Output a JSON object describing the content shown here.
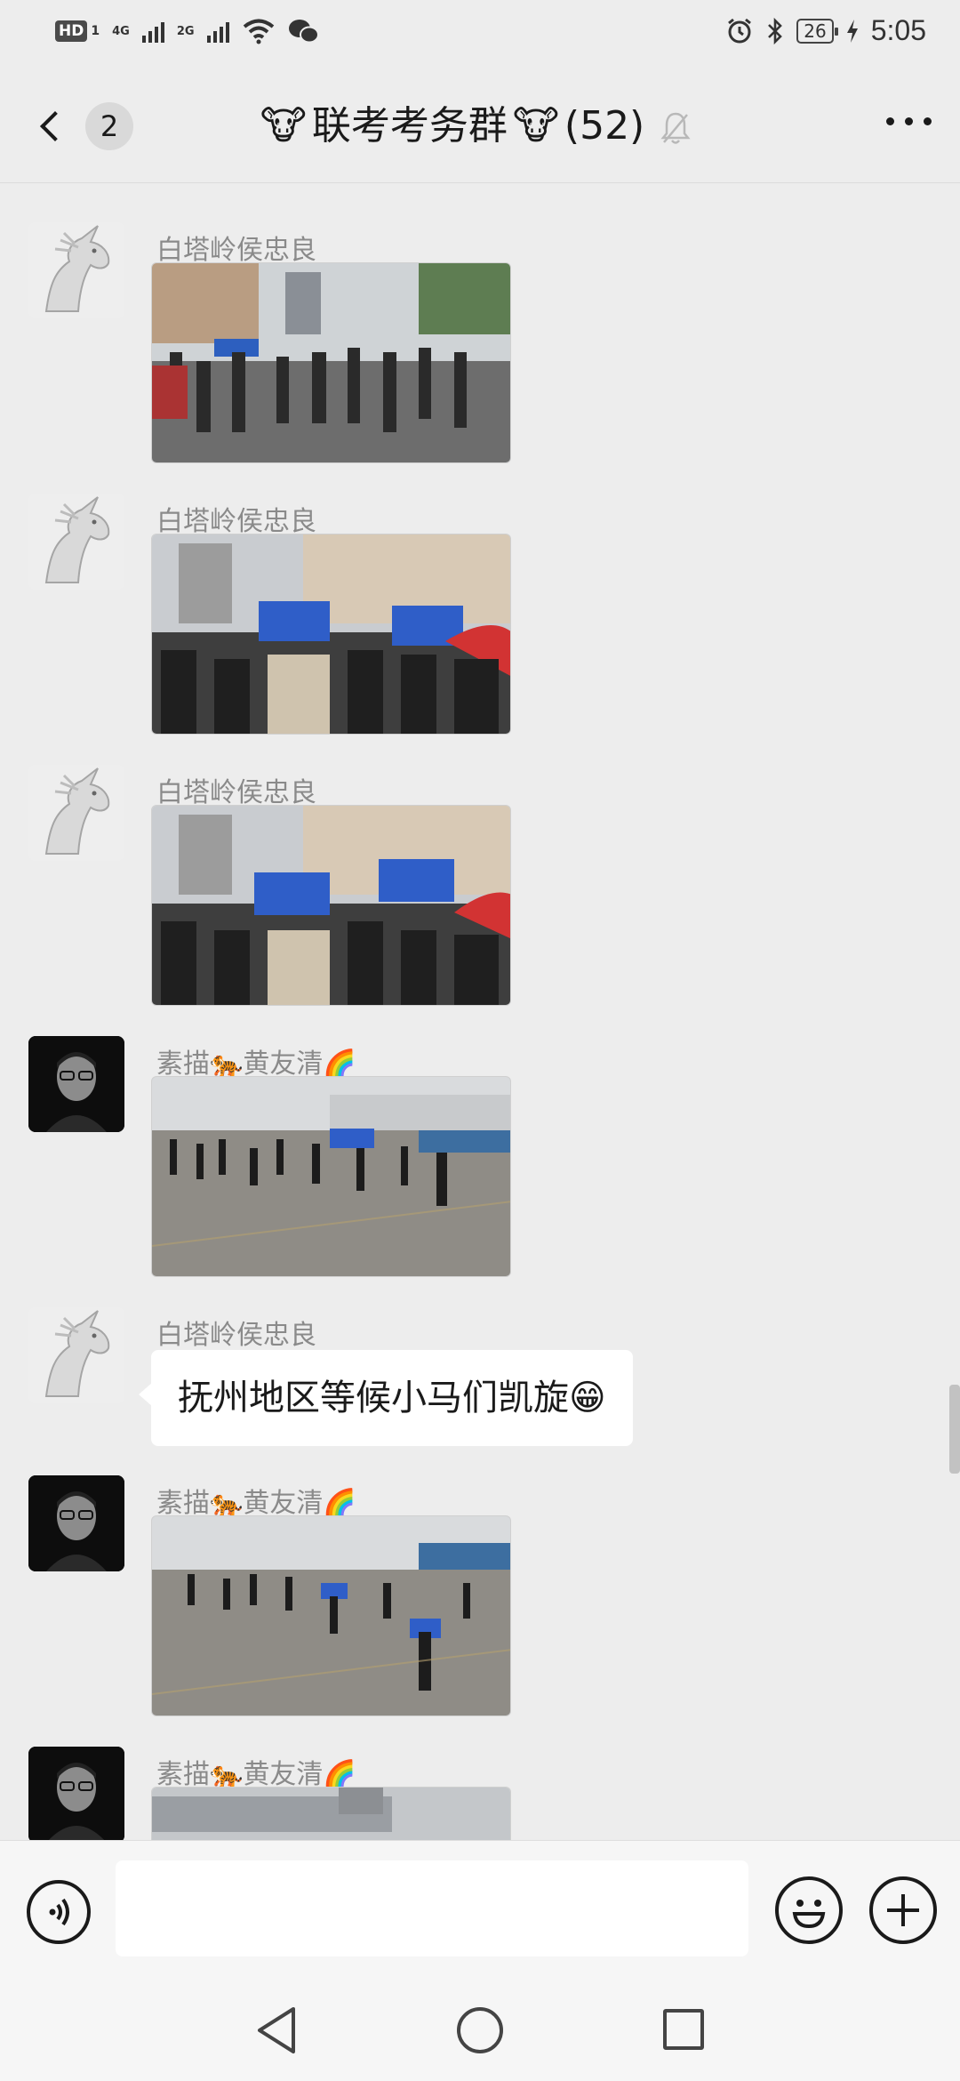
{
  "status_bar": {
    "hd": "HD",
    "sim1": "1",
    "net1": "4G",
    "net2": "2G",
    "battery": "26",
    "time": "5:05"
  },
  "header": {
    "back_count": "2",
    "title_emoji_left": "🐮",
    "title_text": "联考考务群",
    "title_emoji_right": "🐮",
    "member_count": "(52)"
  },
  "messages": [
    {
      "sender": "白塔岭侯忠良",
      "type": "image",
      "avatar": "unicorn-avatar"
    },
    {
      "sender": "白塔岭侯忠良",
      "type": "image",
      "avatar": "unicorn-avatar"
    },
    {
      "sender": "白塔岭侯忠良",
      "type": "image",
      "avatar": "unicorn-avatar"
    },
    {
      "sender": "素描🐅黄友清🌈",
      "type": "image",
      "avatar": "person-avatar"
    },
    {
      "sender": "白塔岭侯忠良",
      "type": "text",
      "text": "抚州地区等候小马们凯旋😁",
      "avatar": "unicorn-avatar"
    },
    {
      "sender": "素描🐅黄友清🌈",
      "type": "image",
      "avatar": "person-avatar"
    },
    {
      "sender": "素描🐅黄友清🌈",
      "type": "image",
      "avatar": "person-avatar"
    }
  ],
  "input": {
    "value": "",
    "placeholder": ""
  },
  "icons": {
    "voice": "voice-icon",
    "emoji": "emoji-icon",
    "plus": "plus-icon",
    "mute": "mute-bell-icon",
    "more": "more-icon"
  },
  "colors": {
    "background": "#ededed",
    "bubble": "#ffffff",
    "sender_name": "#8a8a8a"
  }
}
